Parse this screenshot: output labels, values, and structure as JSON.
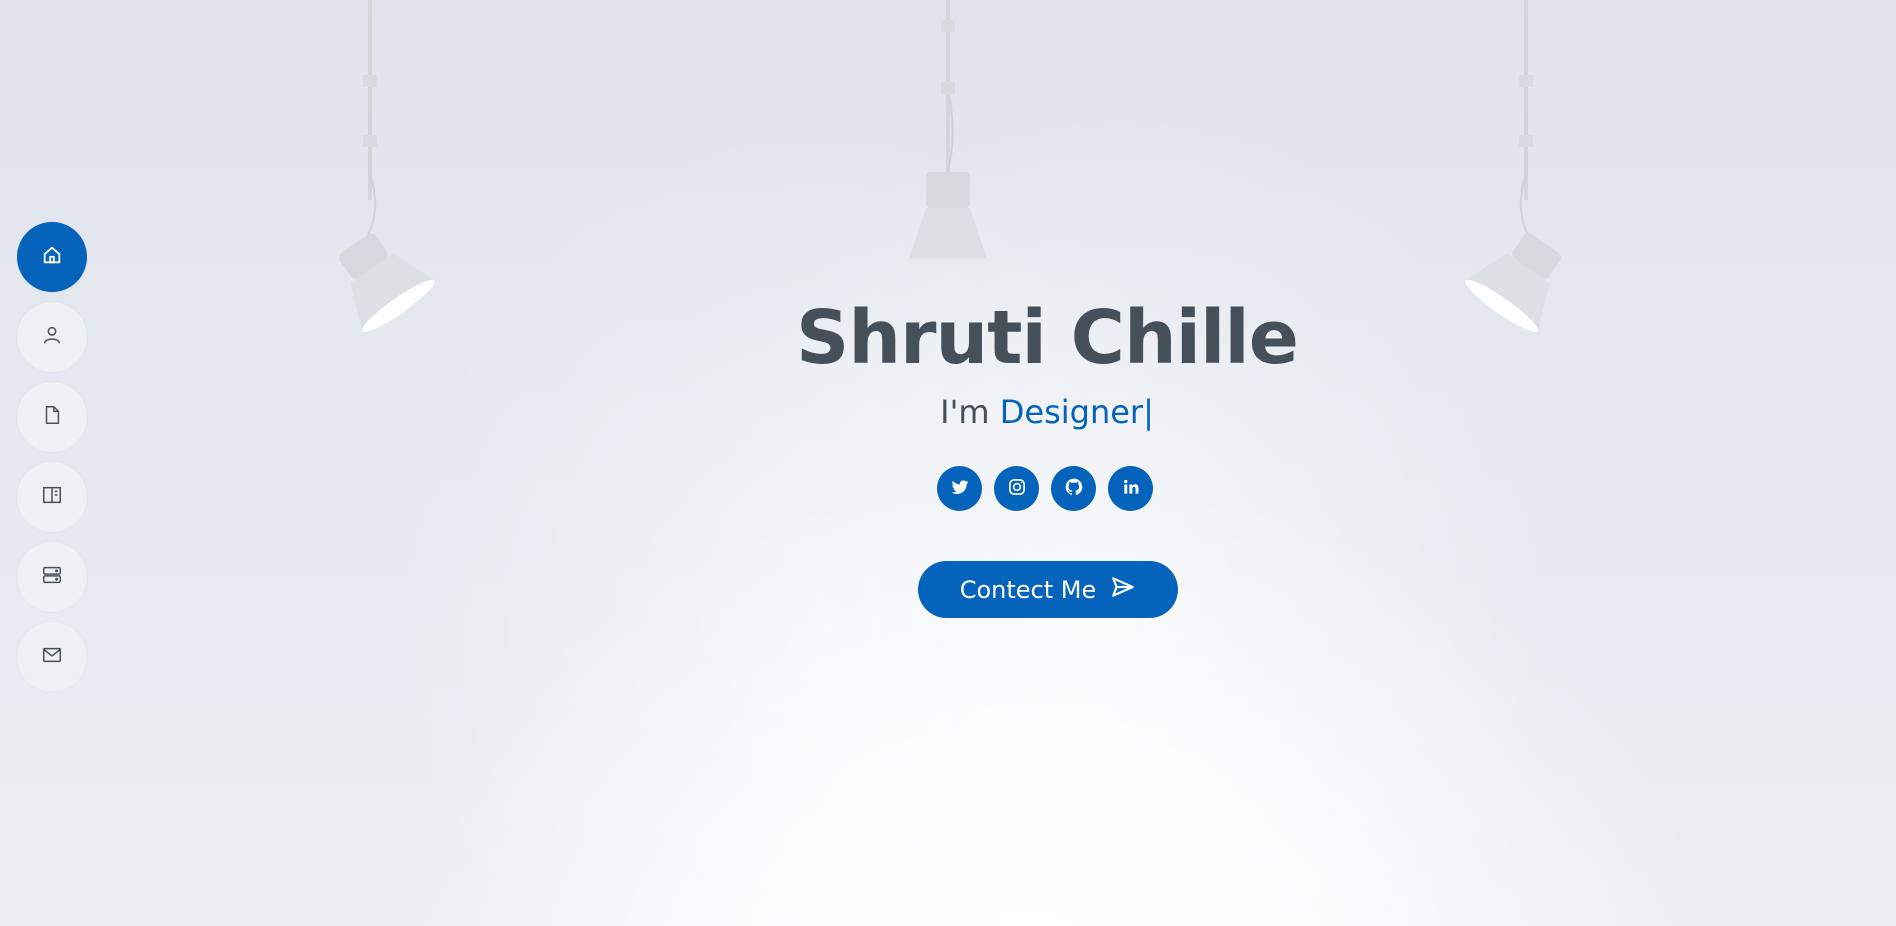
{
  "hero": {
    "name": "Shruti Chille",
    "tagline_prefix": "I'm ",
    "tagline_role": "Designer",
    "cursor": "|",
    "contact_label": "Contect Me"
  },
  "sidebar": {
    "items": [
      {
        "icon": "home-icon",
        "active": true
      },
      {
        "icon": "user-icon",
        "active": false
      },
      {
        "icon": "document-icon",
        "active": false
      },
      {
        "icon": "book-icon",
        "active": false
      },
      {
        "icon": "server-icon",
        "active": false
      },
      {
        "icon": "envelope-icon",
        "active": false
      }
    ]
  },
  "social": [
    {
      "icon": "twitter-icon"
    },
    {
      "icon": "instagram-icon"
    },
    {
      "icon": "github-icon"
    },
    {
      "icon": "linkedin-icon"
    }
  ],
  "colors": {
    "accent": "#0563bb",
    "heading": "#45505b",
    "nav_bg": "#eef0f3"
  }
}
